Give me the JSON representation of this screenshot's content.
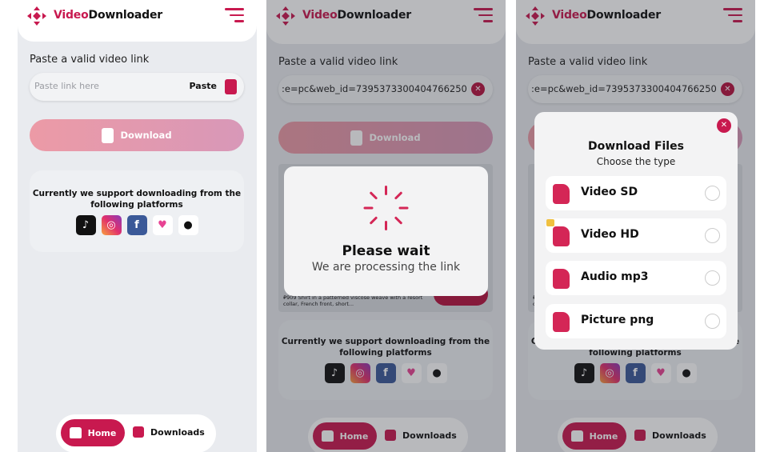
{
  "app": {
    "brand_part1": "Video",
    "brand_part2": "Downloader",
    "accent": "#c8194f"
  },
  "form": {
    "label": "Paste a valid video link",
    "placeholder": "Paste link here",
    "paste_label": "Paste",
    "url_value": ":e=pc&web_id=7395373300404766250",
    "download_label": "Download"
  },
  "support": {
    "text": "Currently we support downloading from the following platforms",
    "platforms": [
      "tiktok",
      "instagram",
      "facebook",
      "likee",
      "snack-video"
    ]
  },
  "nav": {
    "home": "Home",
    "downloads": "Downloads"
  },
  "ad": {
    "text": "₽909 Shirt in a patterned viscose weave with a resort collar, French front, short..."
  },
  "loading": {
    "title": "Please wait",
    "subtitle": "We are processing the link"
  },
  "download_modal": {
    "title": "Download Files",
    "subtitle": "Choose the type",
    "options": [
      {
        "label": "Video SD",
        "selected": false
      },
      {
        "label": "Video HD",
        "selected": false
      },
      {
        "label": "Audio mp3",
        "selected": false
      },
      {
        "label": "Picture png",
        "selected": false
      }
    ]
  }
}
